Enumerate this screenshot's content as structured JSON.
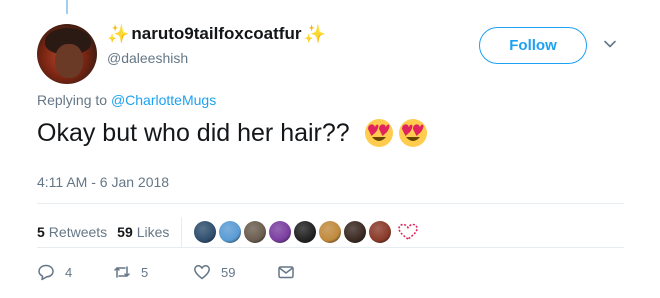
{
  "tweet": {
    "display_name": "naruto9tailfoxcoatfur",
    "name_decoration": "✨",
    "handle": "@daleeshish",
    "follow_label": "Follow",
    "replying_prefix": "Replying to",
    "replying_to": "@CharlotteMugs",
    "text": "Okay but who did her hair??",
    "emojis": [
      "heart-eyes-emoji",
      "heart-eyes-emoji"
    ],
    "timestamp": "4:11 AM - 6 Jan 2018"
  },
  "stats": {
    "retweets_count": "5",
    "retweets_label": "Retweets",
    "likes_count": "59",
    "likes_label": "Likes"
  },
  "likers": [
    {
      "name": "liker-avatar-1",
      "color": "#2f4f6f"
    },
    {
      "name": "liker-avatar-2",
      "color": "#5a9bd4"
    },
    {
      "name": "liker-avatar-3",
      "color": "#6b5d4f"
    },
    {
      "name": "liker-avatar-4",
      "color": "#7b3fa0"
    },
    {
      "name": "liker-avatar-5",
      "color": "#222222"
    },
    {
      "name": "liker-avatar-6",
      "color": "#c08a3e"
    },
    {
      "name": "liker-avatar-7",
      "color": "#3a2a22"
    },
    {
      "name": "liker-avatar-8",
      "color": "#8a3b2a"
    }
  ],
  "actions": {
    "replies": "4",
    "retweets": "5",
    "likes": "59"
  },
  "colors": {
    "accent": "#1da1f2",
    "muted": "#657786",
    "text": "#14171a",
    "divider": "#e6ecf0",
    "like_heart": "#e0245e"
  }
}
